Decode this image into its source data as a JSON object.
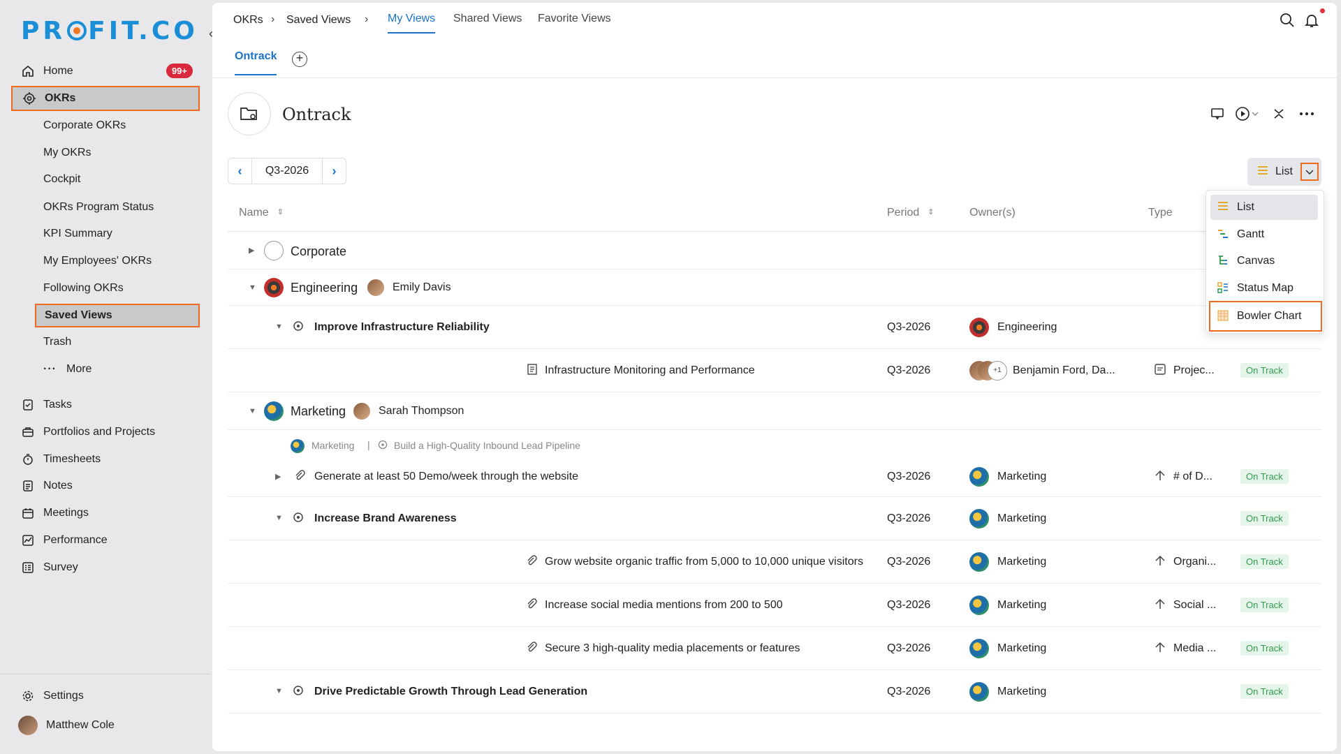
{
  "app": {
    "logo_text_pre": "PR",
    "logo_text_post": "FIT.CO"
  },
  "sidebar": {
    "home": {
      "label": "Home",
      "badge": "99+"
    },
    "okrs": {
      "label": "OKRs"
    },
    "okr_sub": [
      "Corporate OKRs",
      "My OKRs",
      "Cockpit",
      "OKRs Program Status",
      "KPI Summary",
      "My Employees' OKRs",
      "Following OKRs",
      "Saved Views",
      "Trash",
      "More"
    ],
    "items": [
      "Tasks",
      "Portfolios and Projects",
      "Timesheets",
      "Notes",
      "Meetings",
      "Performance",
      "Survey"
    ],
    "settings": "Settings",
    "user": "Matthew Cole"
  },
  "topbar": {
    "crumbs": [
      "OKRs",
      "Saved Views"
    ],
    "tabs": [
      "My Views",
      "Shared Views",
      "Favorite Views"
    ]
  },
  "subtab": "Ontrack",
  "view": {
    "title": "Ontrack",
    "period": "Q3-2026",
    "layout": "List"
  },
  "dropdown": [
    "List",
    "Gantt",
    "Canvas",
    "Status Map",
    "Bowler Chart"
  ],
  "table": {
    "headers": {
      "name": "Name",
      "period": "Period",
      "owners": "Owner(s)",
      "type": "Type"
    },
    "groups": {
      "corporate": "Corporate",
      "engineering": {
        "name": "Engineering",
        "owner": "Emily Davis"
      },
      "marketing": {
        "name": "Marketing",
        "owner": "Sarah Thompson"
      }
    },
    "rows": [
      {
        "name": "Improve Infrastructure Reliability",
        "period": "Q3-2026",
        "owner": "Engineering",
        "type": "",
        "status": ""
      },
      {
        "name": "Infrastructure Monitoring and Performance",
        "period": "Q3-2026",
        "owner": "Benjamin Ford, Da...",
        "owner_extra": "+1",
        "type": "Projec...",
        "status": "On Track"
      },
      {
        "name": "Generate at least 50 Demo/week through the website",
        "period": "Q3-2026",
        "owner": "Marketing",
        "type": "# of D...",
        "status": "On Track"
      },
      {
        "name": "Increase Brand Awareness",
        "period": "Q3-2026",
        "owner": "Marketing",
        "type": "",
        "status": "On Track"
      },
      {
        "name": "Grow website organic traffic from 5,000 to 10,000 unique visitors",
        "period": "Q3-2026",
        "owner": "Marketing",
        "type": "Organi...",
        "status": "On Track"
      },
      {
        "name": "Increase social media mentions from 200 to 500",
        "period": "Q3-2026",
        "owner": "Marketing",
        "type": "Social ...",
        "status": "On Track"
      },
      {
        "name": "Secure 3 high-quality media placements or features",
        "period": "Q3-2026",
        "owner": "Marketing",
        "type": "Media ...",
        "status": "On Track"
      },
      {
        "name": "Drive Predictable Growth Through Lead Generation",
        "period": "Q3-2026",
        "owner": "Marketing",
        "type": "",
        "status": "On Track"
      }
    ],
    "parent_meta": {
      "team": "Marketing",
      "objective": "Build a High-Quality Inbound Lead Pipeline"
    }
  },
  "colors": {
    "accent": "#1a73c9",
    "highlight": "#ee6a1f",
    "on_track": "#2f9a4d",
    "badge": "#d82a3c"
  }
}
